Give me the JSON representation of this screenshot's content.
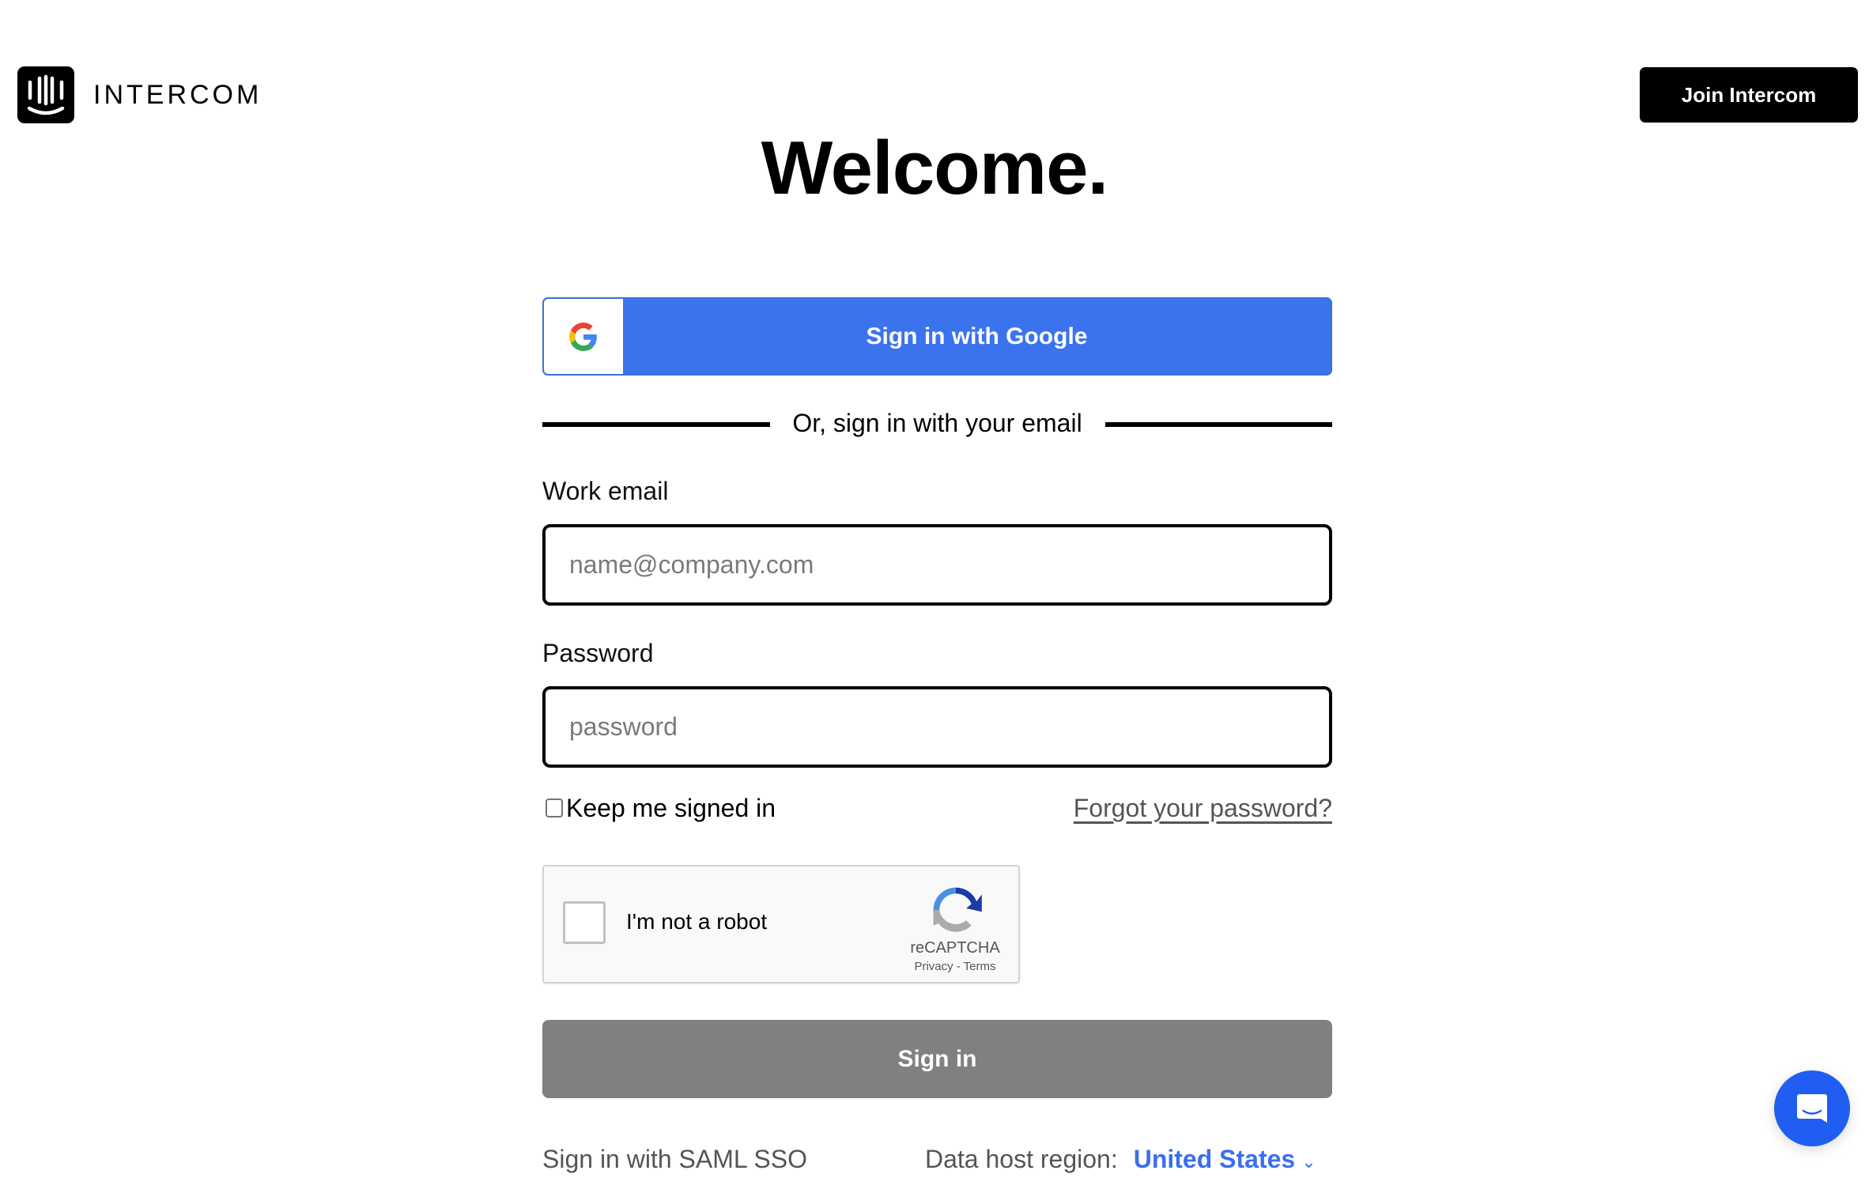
{
  "header": {
    "logo_text": "INTERCOM",
    "join_button": "Join Intercom"
  },
  "main": {
    "title": "Welcome.",
    "google_button": "Sign in with Google",
    "divider_text": "Or, sign in with your email",
    "email": {
      "label": "Work email",
      "placeholder": "name@company.com",
      "value": ""
    },
    "password": {
      "label": "Password",
      "placeholder": "password",
      "value": ""
    },
    "keep_signed_in": {
      "label": "Keep me signed in",
      "checked": false
    },
    "forgot_password": "Forgot your password?",
    "recaptcha": {
      "label": "I'm not a robot",
      "brand": "reCAPTCHA",
      "links": "Privacy - Terms"
    },
    "signin_button": "Sign in",
    "saml_link": "Sign in with SAML SSO",
    "region": {
      "label": "Data host region:",
      "value": "United States"
    }
  },
  "colors": {
    "google_blue": "#3b73ef",
    "signin_disabled": "#808080",
    "link_blue": "#3b6ef0",
    "launcher_blue": "#1f5ef0"
  }
}
